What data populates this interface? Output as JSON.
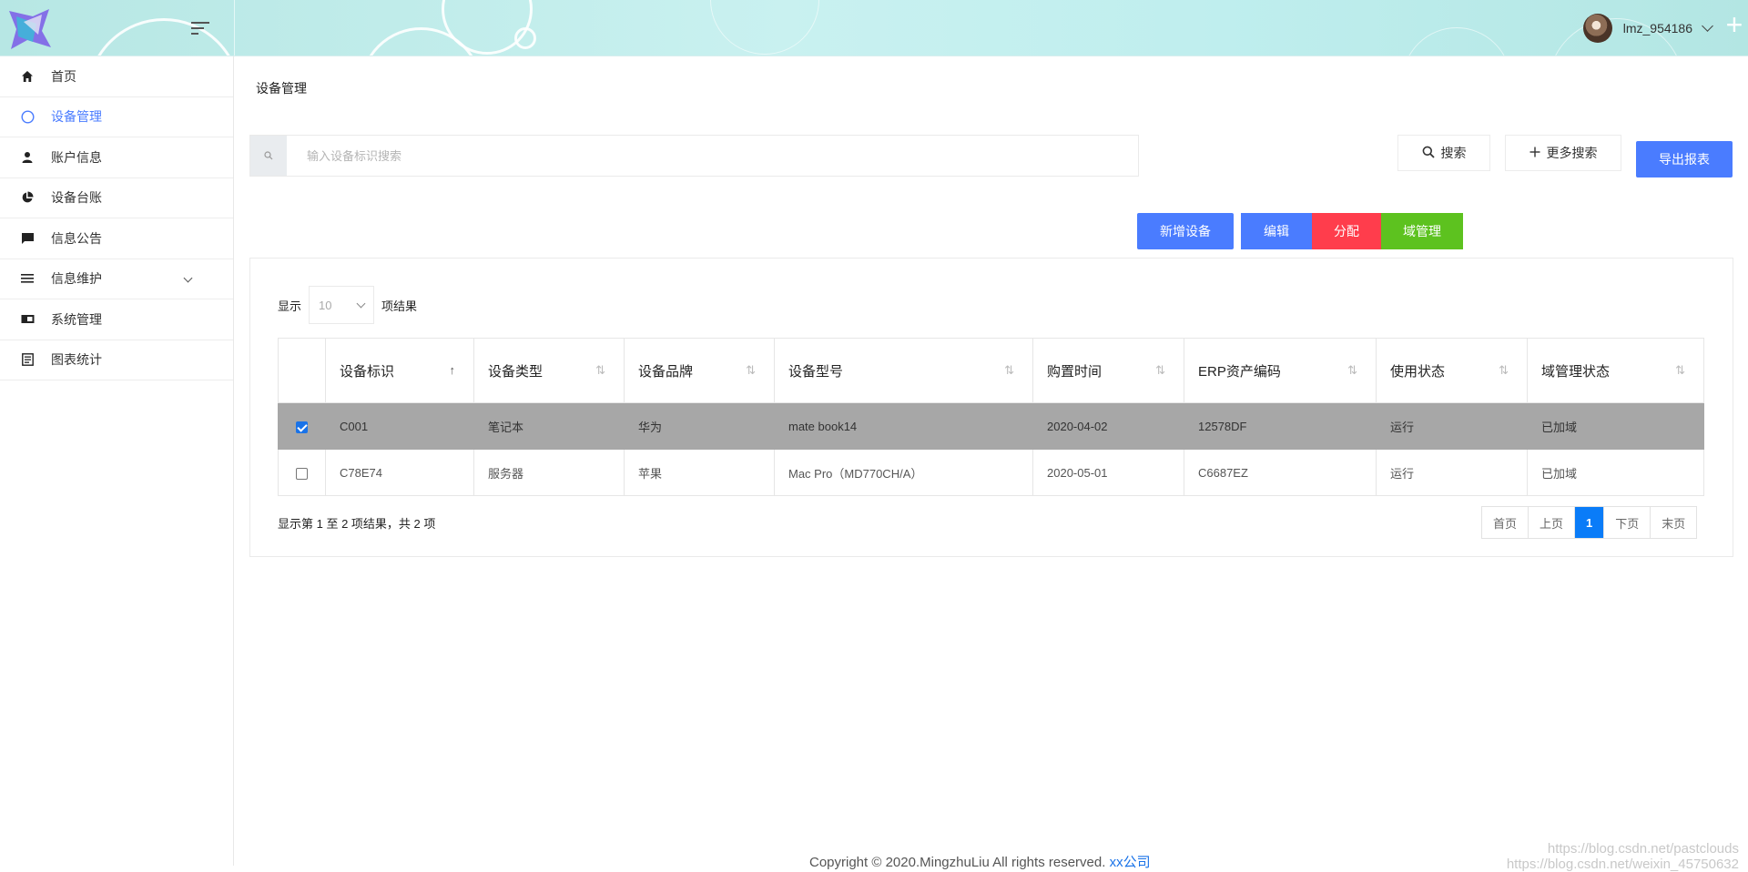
{
  "header": {
    "username": "lmz_954186"
  },
  "sidebar": {
    "items": [
      {
        "label": "首页",
        "icon": "home-icon"
      },
      {
        "label": "设备管理",
        "icon": "circle-icon",
        "active": true
      },
      {
        "label": "账户信息",
        "icon": "user-icon"
      },
      {
        "label": "设备台账",
        "icon": "pie-chart-icon"
      },
      {
        "label": "信息公告",
        "icon": "message-icon"
      },
      {
        "label": "信息维护",
        "icon": "list-icon",
        "expandable": true
      },
      {
        "label": "系统管理",
        "icon": "id-card-icon"
      },
      {
        "label": "图表统计",
        "icon": "document-icon"
      }
    ]
  },
  "main": {
    "page_title": "设备管理",
    "search": {
      "placeholder": "输入设备标识搜索",
      "value": ""
    },
    "buttons": {
      "search": "搜索",
      "more_search": "更多搜索",
      "export": "导出报表",
      "add": "新增设备",
      "edit": "编辑",
      "assign": "分配",
      "domain": "域管理"
    },
    "length": {
      "prefix": "显示",
      "value": "10",
      "suffix": "项结果"
    },
    "table": {
      "columns": [
        "设备标识",
        "设备类型",
        "设备品牌",
        "设备型号",
        "购置时间",
        "ERP资产编码",
        "使用状态",
        "域管理状态"
      ],
      "rows": [
        {
          "selected": true,
          "cells": [
            "C001",
            "笔记本",
            "华为",
            "mate book14",
            "2020-04-02",
            "12578DF",
            "运行",
            "已加域"
          ]
        },
        {
          "selected": false,
          "cells": [
            "C78E74",
            "服务器",
            "苹果",
            "Mac Pro（MD770CH/A）",
            "2020-05-01",
            "C6687EZ",
            "运行",
            "已加域"
          ]
        }
      ]
    },
    "info": "显示第 1 至 2 项结果，共 2 项",
    "pagination": {
      "first": "首页",
      "prev": "上页",
      "current": "1",
      "next": "下页",
      "last": "末页"
    }
  },
  "footer": {
    "copyright": "Copyright © 2020.MingzhuLiu All rights reserved.",
    "company": "xx公司"
  },
  "watermark": {
    "line1": "https://blog.csdn.net/pastclouds",
    "line2": "https://blog.csdn.net/weixin_45750632"
  },
  "colors": {
    "primary": "#4a7cff",
    "danger": "#ff3d4c",
    "success": "#5dc21f",
    "selected_row": "#a7a7a7",
    "pager_current": "#0a7cf8"
  }
}
